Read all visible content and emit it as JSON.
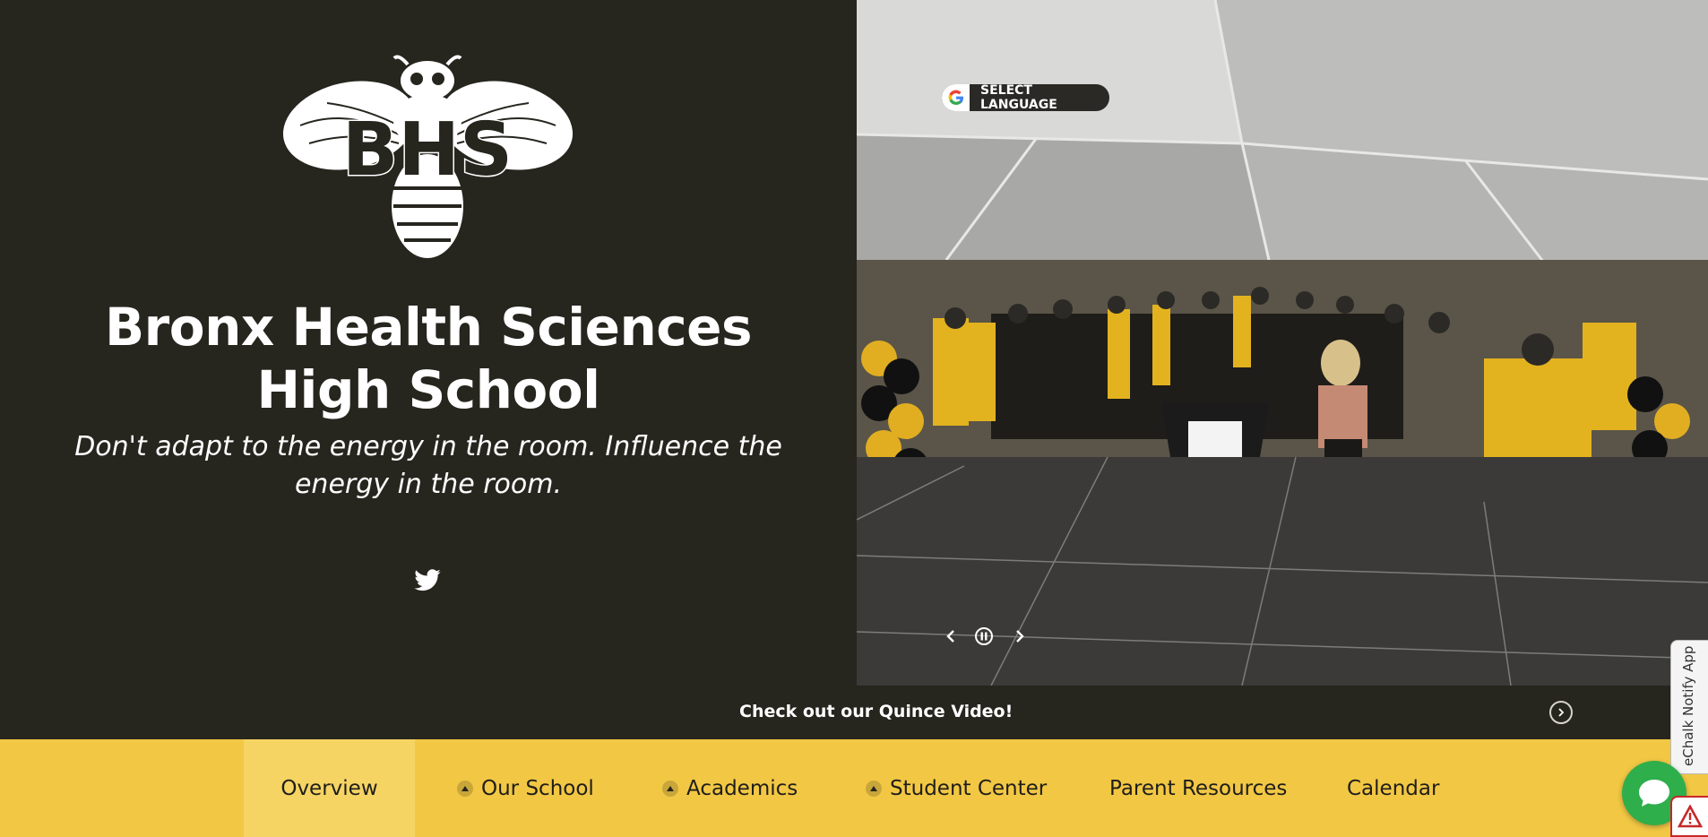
{
  "school": {
    "name": "Bronx Health Sciences High School",
    "tagline": "Don't adapt to the energy in the room. Influence the energy in the room.",
    "logo_text": "BHS"
  },
  "social": {
    "twitter_icon": "twitter-icon"
  },
  "translate": {
    "label": "SELECT LANGUAGE",
    "icon": "google-icon"
  },
  "slider": {
    "prev_icon": "chevron-left-icon",
    "pause_icon": "pause-icon",
    "next_icon": "chevron-right-icon"
  },
  "announcement": {
    "text": "Check out our Quince Video!",
    "next_icon": "chevron-right-icon"
  },
  "nav": {
    "items": [
      {
        "label": "Overview",
        "has_caret": false,
        "active": true
      },
      {
        "label": "Our School",
        "has_caret": true,
        "active": false
      },
      {
        "label": "Academics",
        "has_caret": true,
        "active": false
      },
      {
        "label": "Student Center",
        "has_caret": true,
        "active": false
      },
      {
        "label": "Parent Resources",
        "has_caret": false,
        "active": false
      },
      {
        "label": "Calendar",
        "has_caret": false,
        "active": false
      }
    ]
  },
  "widgets": {
    "notify_label": "eChalk Notify App",
    "chat_icon": "chat-icon",
    "alert_icon": "alert-icon"
  },
  "colors": {
    "dark": "#26251e",
    "accent": "#f2c744",
    "accent_active": "#f5d463",
    "chat": "#2eaf4b"
  }
}
